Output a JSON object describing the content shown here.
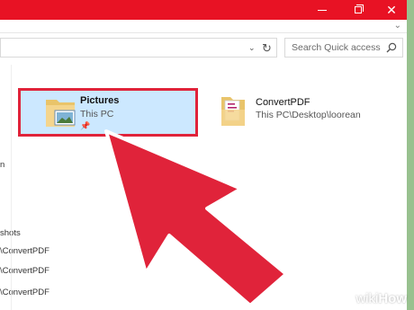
{
  "colors": {
    "title_bar": "#e81224",
    "selection_bg": "#cce8ff",
    "highlight_border": "#e0233a",
    "arrow": "#e0233a",
    "frame": "#98c18f"
  },
  "window": {
    "controls": [
      "minimize-icon",
      "maximize-icon",
      "close-icon"
    ],
    "close_glyph": "✕"
  },
  "address_bar": {
    "dropdown_glyph": "⌄",
    "refresh_glyph": "↻"
  },
  "search": {
    "placeholder": "Search Quick access",
    "icon": "search-icon"
  },
  "ribbon": {
    "expand_glyph": "⌄"
  },
  "nav_pane": {
    "items": [
      "n",
      "shots",
      "\\ConvertPDF",
      "\\ConvertPDF",
      "\\ConvertPDF"
    ]
  },
  "quick_access": {
    "items": [
      {
        "name": "Pictures",
        "path": "This PC",
        "pinned": true,
        "icon": "pictures-folder-icon",
        "selected": true
      },
      {
        "name": "ConvertPDF",
        "path": "This PC\\Desktop\\loorean",
        "pinned": false,
        "icon": "folder-icon",
        "selected": false
      }
    ],
    "pin_glyph": "📌"
  },
  "watermark": {
    "prefix": "wiki",
    "suffix": "How"
  }
}
